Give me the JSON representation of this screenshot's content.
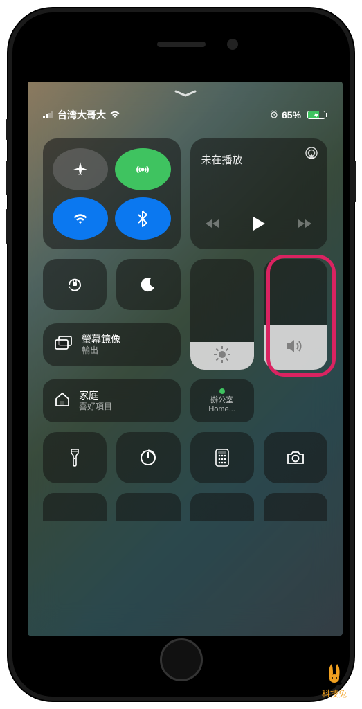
{
  "status": {
    "carrier": "台湾大哥大",
    "battery_percent": "65%",
    "battery_level": 65
  },
  "connectivity": {
    "airplane_icon": "airplane",
    "cellular_icon": "antenna",
    "wifi_icon": "wifi",
    "bluetooth_icon": "bluetooth"
  },
  "media": {
    "now_playing_label": "未在播放"
  },
  "toggles": {
    "orientation_lock": "rotation-lock",
    "do_not_disturb": "moon"
  },
  "screen_mirroring": {
    "title": "螢幕鏡像",
    "subtitle": "輸出"
  },
  "sliders": {
    "brightness_percent": 25,
    "volume_percent": 40
  },
  "home_module": {
    "title": "家庭",
    "subtitle": "喜好項目"
  },
  "home_tile": {
    "line1": "辦公室",
    "line2": "Home..."
  },
  "icons_row": [
    "flashlight",
    "timer",
    "calculator",
    "camera"
  ],
  "watermark": "科技兔"
}
